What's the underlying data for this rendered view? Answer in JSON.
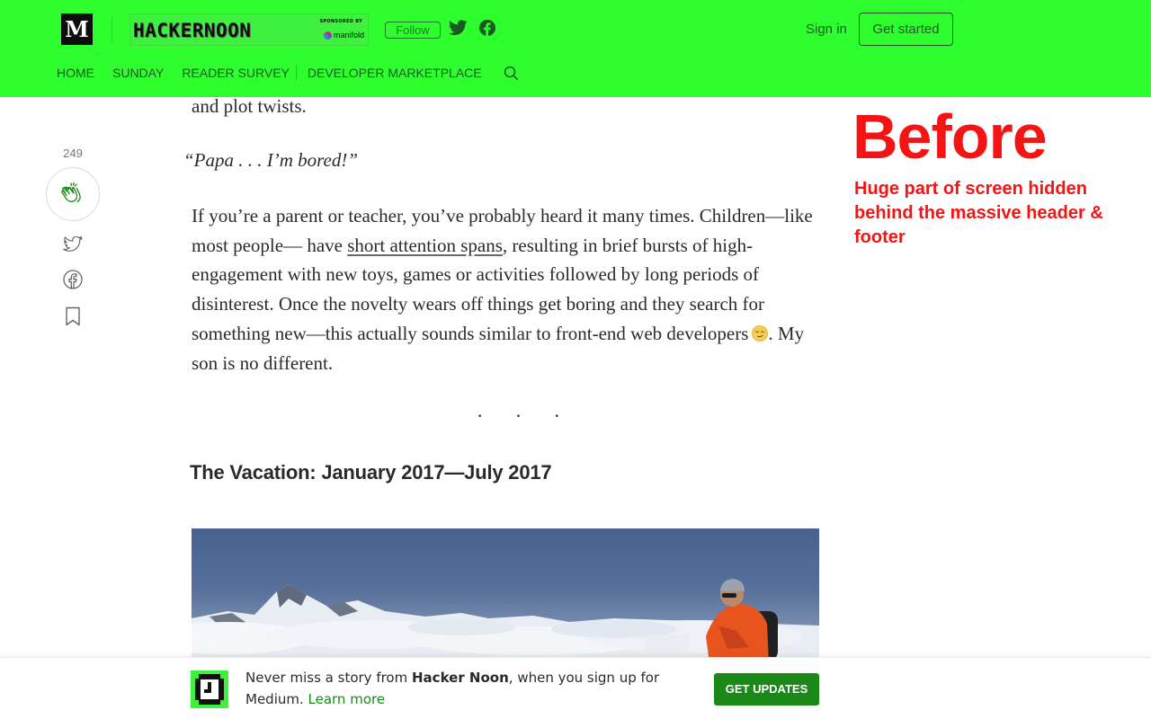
{
  "colors": {
    "header_bg": "#2efd2e",
    "brand_green": "#1a8917",
    "annotation_red": "#f41414"
  },
  "header": {
    "medium_logo": "M",
    "publication": {
      "name": "HACKERNOON",
      "sponsored_by": "SPONSORED BY",
      "sponsor": "manifold"
    },
    "follow_label": "Follow",
    "icons": [
      "twitter-icon",
      "facebook-icon"
    ],
    "sign_in": "Sign in",
    "get_started": "Get started",
    "nav": [
      {
        "label": "HOME"
      },
      {
        "label": "SUNDAY"
      },
      {
        "label": "READER SURVEY"
      },
      {
        "label": "DEVELOPER MARKETPLACE"
      }
    ]
  },
  "sidebar": {
    "clap_count": "249",
    "icons": [
      "clap-icon",
      "twitter-icon",
      "facebook-icon",
      "bookmark-icon"
    ]
  },
  "article": {
    "fragment": "and plot twists.",
    "quote": "“Papa . . . I’m bored!”",
    "paragraph": {
      "before_link": "If you’re a parent or teacher, you’ve probably heard it many times. Children—like most people— have ",
      "link": "short attention spans",
      "after_link": ", resulting in brief bursts of high-engagement with new toys, games or activities followed by long periods of disinterest. Once the novelty wears off things get boring and they search for something new—this actually sounds similar to front-end web developers",
      "emoji": "smirk-emoji",
      "end": ". My son is no different."
    },
    "separator": "· · ·",
    "section_title": "The Vacation: January 2017—July 2017",
    "image": "photo of a mountaineer with a laptop above the clouds on a snowy mountain"
  },
  "annotation": {
    "title": "Before",
    "note": "Huge part of screen hidden behind the massive header & footer"
  },
  "footer": {
    "text_before": "Never miss a story from ",
    "publication": "Hacker Noon",
    "text_after": ", when you sign up for Medium. ",
    "learn_more": "Learn more",
    "button": "GET UPDATES"
  }
}
